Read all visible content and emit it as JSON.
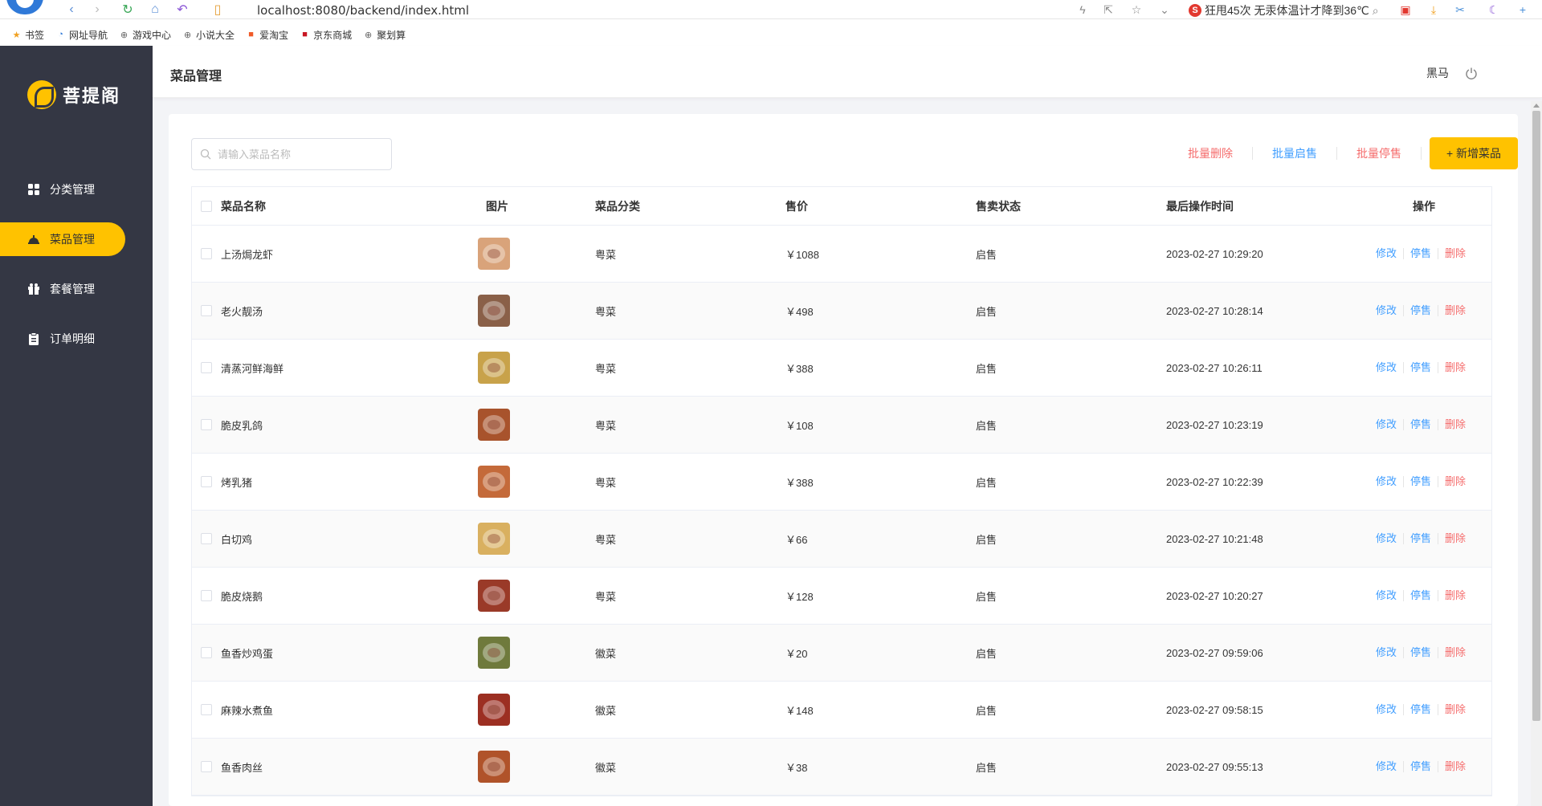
{
  "browser": {
    "url": "localhost:8080/backend/index.html",
    "news": "狂甩45次 无汞体温计才降到36℃",
    "bookmarks": [
      "书签",
      "网址导航",
      "游戏中心",
      "小说大全",
      "爱淘宝",
      "京东商城",
      "聚划算"
    ]
  },
  "sidebar": {
    "brand": "菩提阁",
    "items": [
      {
        "label": "分类管理",
        "icon": "grid-icon"
      },
      {
        "label": "菜品管理",
        "icon": "cloche-icon",
        "active": true
      },
      {
        "label": "套餐管理",
        "icon": "gift-icon"
      },
      {
        "label": "订单明细",
        "icon": "clipboard-icon"
      }
    ]
  },
  "header": {
    "title": "菜品管理",
    "user": "黑马"
  },
  "toolbar": {
    "search_placeholder": "请输入菜品名称",
    "batch_delete": "批量删除",
    "batch_enable": "批量启售",
    "batch_disable": "批量停售",
    "add": "+ 新增菜品"
  },
  "table": {
    "columns": [
      "菜品名称",
      "图片",
      "菜品分类",
      "售价",
      "售卖状态",
      "最后操作时间",
      "操作"
    ],
    "ops": [
      "修改",
      "停售",
      "删除"
    ],
    "rows": [
      {
        "name": "上汤焗龙虾",
        "category": "粤菜",
        "price": "￥1088",
        "status": "启售",
        "time": "2023-02-27 10:29:20",
        "thumb": "#d9a37a"
      },
      {
        "name": "老火靓汤",
        "category": "粤菜",
        "price": "￥498",
        "status": "启售",
        "time": "2023-02-27 10:28:14",
        "thumb": "#8a6048"
      },
      {
        "name": "清蒸河鲜海鲜",
        "category": "粤菜",
        "price": "￥388",
        "status": "启售",
        "time": "2023-02-27 10:26:11",
        "thumb": "#c8a24a"
      },
      {
        "name": "脆皮乳鸽",
        "category": "粤菜",
        "price": "￥108",
        "status": "启售",
        "time": "2023-02-27 10:23:19",
        "thumb": "#a8532c"
      },
      {
        "name": "烤乳猪",
        "category": "粤菜",
        "price": "￥388",
        "status": "启售",
        "time": "2023-02-27 10:22:39",
        "thumb": "#c46a3a"
      },
      {
        "name": "白切鸡",
        "category": "粤菜",
        "price": "￥66",
        "status": "启售",
        "time": "2023-02-27 10:21:48",
        "thumb": "#d9b060"
      },
      {
        "name": "脆皮烧鹅",
        "category": "粤菜",
        "price": "￥128",
        "status": "启售",
        "time": "2023-02-27 10:20:27",
        "thumb": "#9a3a28"
      },
      {
        "name": "鱼香炒鸡蛋",
        "category": "徽菜",
        "price": "￥20",
        "status": "启售",
        "time": "2023-02-27 09:59:06",
        "thumb": "#6f7a3c"
      },
      {
        "name": "麻辣水煮鱼",
        "category": "徽菜",
        "price": "￥148",
        "status": "启售",
        "time": "2023-02-27 09:58:15",
        "thumb": "#9c2f22"
      },
      {
        "name": "鱼香肉丝",
        "category": "徽菜",
        "price": "￥38",
        "status": "启售",
        "time": "2023-02-27 09:55:13",
        "thumb": "#b0532a"
      }
    ]
  },
  "colors": {
    "accent": "#ffc200",
    "sidebar": "#343744",
    "link_blue": "#419eff",
    "link_red": "#f56c6c"
  }
}
